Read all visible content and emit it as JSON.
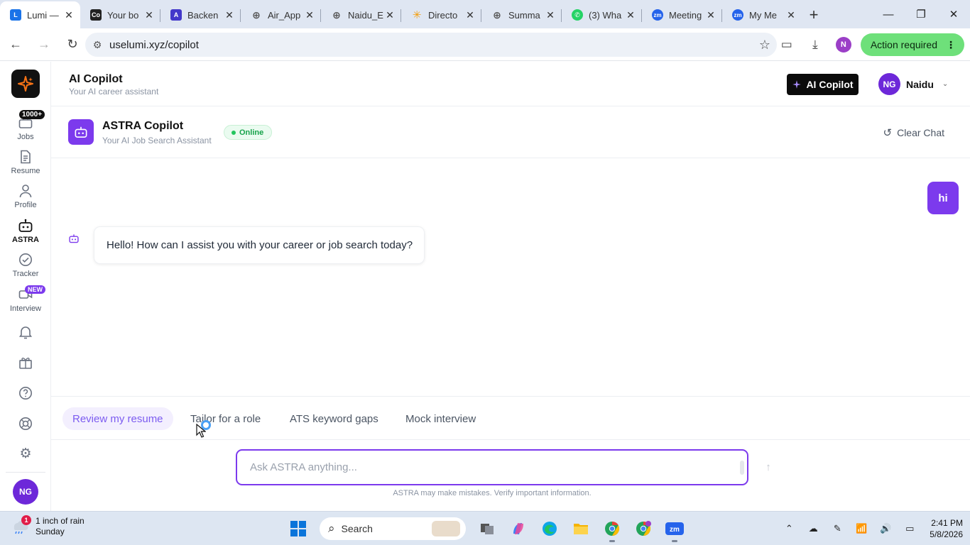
{
  "browser": {
    "tabs": [
      {
        "title": "Lumi —",
        "favicon": "L",
        "color": "#1a73e8",
        "active": true
      },
      {
        "title": "Your bo",
        "favicon": "C",
        "color": "#222222",
        "active": false
      },
      {
        "title": "Backen",
        "favicon": "A",
        "color": "#4338ca",
        "active": false
      },
      {
        "title": "Air_App",
        "favicon": "globe",
        "color": "#555555",
        "active": false
      },
      {
        "title": "Naidu_E",
        "favicon": "globe",
        "color": "#555555",
        "active": false
      },
      {
        "title": "Directo",
        "favicon": "spark",
        "color": "#f59e0b",
        "active": false
      },
      {
        "title": "Summa",
        "favicon": "globe",
        "color": "#555555",
        "active": false
      },
      {
        "title": "(3) Wha",
        "favicon": "whatsapp",
        "color": "#25d366",
        "active": false
      },
      {
        "title": "Meeting",
        "favicon": "zm",
        "color": "#2563eb",
        "active": false
      },
      {
        "title": "My Me",
        "favicon": "zm",
        "color": "#2563eb",
        "active": false
      }
    ],
    "url": "uselumi.xyz/copilot",
    "profile_initial": "N",
    "action_required": "Action required"
  },
  "sidebar": {
    "items": [
      {
        "label": "Jobs",
        "icon": "briefcase-icon",
        "badge": "1000+"
      },
      {
        "label": "Resume",
        "icon": "document-icon"
      },
      {
        "label": "Profile",
        "icon": "user-icon"
      },
      {
        "label": "ASTRA",
        "icon": "robot-icon",
        "active": true
      },
      {
        "label": "Tracker",
        "icon": "check-circle-icon"
      },
      {
        "label": "Interview",
        "icon": "video-icon",
        "badge": "NEW"
      }
    ],
    "avatar": "NG"
  },
  "header": {
    "title": "AI Copilot",
    "subtitle": "Your AI career assistant",
    "copilot_button": "AI Copilot",
    "user_initials": "NG",
    "user_name": "Naidu"
  },
  "chat": {
    "bot_name": "ASTRA Copilot",
    "bot_subtitle": "Your AI Job Search Assistant",
    "status": "Online",
    "clear_label": "Clear Chat",
    "messages": [
      {
        "role": "user",
        "text": "hi"
      },
      {
        "role": "bot",
        "text": "Hello! How can I assist you with your career or job search today?"
      }
    ],
    "suggestions": [
      "Review my resume",
      "Tailor for a role",
      "ATS keyword gaps",
      "Mock interview"
    ],
    "input_placeholder": "Ask ASTRA anything...",
    "input_value": "",
    "disclaimer": "ASTRA may make mistakes. Verify important information."
  },
  "taskbar": {
    "weather_line1": "1 inch of rain",
    "weather_line2": "Sunday",
    "weather_badge": "1",
    "search_label": "Search",
    "time": "2:41 PM",
    "date": "5/8/2026"
  },
  "colors": {
    "accent": "#7c3aed",
    "online": "#22c55e",
    "action_required_bg": "#6ee07a"
  }
}
